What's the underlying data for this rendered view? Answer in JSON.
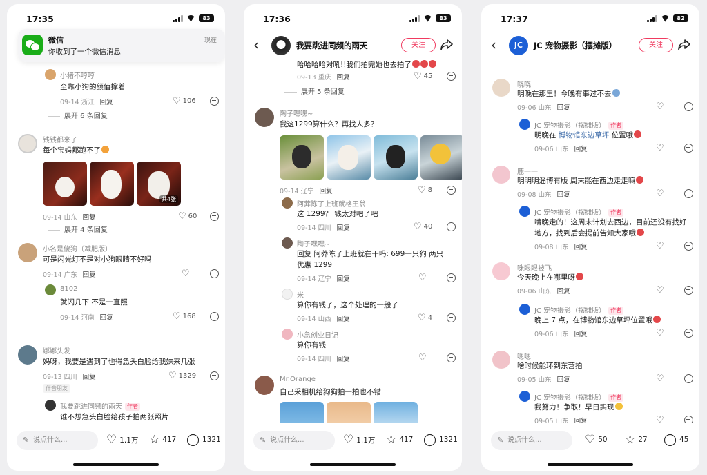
{
  "phones": [
    {
      "time": "17:35",
      "battery": "83",
      "notification": {
        "title": "微信",
        "body": "你收到了一个微信消息",
        "time": "现在"
      },
      "comments": [
        {
          "name": "小猪不哼哼",
          "text": "全靠小狗的颜值撑着",
          "date": "09-14 浙江",
          "reply": "回复",
          "likes": "106"
        },
        {
          "expand": "展开 6 条回复"
        },
        {
          "name": "钱钱都来了",
          "text": "每个宝妈都跑不了",
          "date": "09-14 山东",
          "reply": "回复",
          "likes": "60",
          "image_badge": "共4张"
        },
        {
          "expand": "展开 4 条回复"
        },
        {
          "name": "小名是傻狗（减肥版）",
          "text": "可是闪光灯不是对小狗眼睛不好吗",
          "date": "09-14 广东",
          "reply": "回复",
          "likes": ""
        },
        {
          "name": "8102",
          "text": "就闪几下 不是一直照",
          "date": "09-14 河南",
          "reply": "回复",
          "likes": "168"
        },
        {
          "name": "娜娜头发",
          "text": "妈呀，我要是遇到了也得急头白脸给我妹来几张",
          "date": "09-13 四川",
          "reply": "回复",
          "likes": "1329",
          "badge": "伴音朋友"
        },
        {
          "name": "我要跳进同频的雨天",
          "author_tag": "作者",
          "text": "谁不想急头白脸给孩子拍两张照片"
        }
      ],
      "bottom": {
        "placeholder": "说点什么...",
        "likes": "1.1万",
        "stars": "417",
        "comments": "1321"
      }
    },
    {
      "time": "17:36",
      "battery": "83",
      "title": "我要跳进同频的雨天",
      "follow": "关注",
      "comments": [
        {
          "text": "哈哈哈哈对吼!!我们拍完她也去拍了",
          "date": "09-13 重庆",
          "reply": "回复",
          "likes": "45"
        },
        {
          "expand": "展开 5 条回复"
        },
        {
          "name": "陶子嘿嘿~",
          "text": "我这1299算什么？再找人多？",
          "date": "09-14 辽宁",
          "reply": "回复",
          "likes": "8"
        },
        {
          "name": "阿莽陈了上班就格王翁",
          "text": "这 1299？ 钱太对吧了吧",
          "date": "09-14 四川",
          "reply": "回复",
          "likes": "40"
        },
        {
          "name": "陶子嘿嘿~",
          "text": "回复 阿莽陈了上班就在干吗: 699一只狗 两只",
          "text2": "优惠 1299",
          "date": "09-14 辽宁",
          "reply": "回复",
          "likes": ""
        },
        {
          "name": "米",
          "text": "算你有钱了，这个处理的一般了",
          "date": "09-14 山西",
          "reply": "回复",
          "likes": "4"
        },
        {
          "name": "小急创业日记",
          "text": "算你有钱",
          "date": "09-14 四川",
          "reply": "回复",
          "likes": ""
        },
        {
          "name": "Mr.Orange",
          "text": "自己采相机给狗狗拍一拍也不错"
        }
      ],
      "bottom": {
        "placeholder": "说点什么...",
        "likes": "1.1万",
        "stars": "417",
        "comments": "1321"
      }
    },
    {
      "time": "17:37",
      "battery": "82",
      "title": "JC 宠物摄影（摆摊版）",
      "follow": "关注",
      "comments": [
        {
          "name": "晓晓",
          "text": "明晚在那里！今晚有事过不去",
          "date": "09-06 山东",
          "reply": "回复"
        },
        {
          "name": "JC 宠物摄影（摆摊版）",
          "author_tag": "作者",
          "text_pre": "明晚在 ",
          "text_link": "博物馆东边草坪",
          "text_post": " 位置哦",
          "date": "09-06 山东",
          "reply": "回复"
        },
        {
          "name": "鹿一一",
          "text": "明明明淄博有版 周末能在西边走走嘛",
          "date": "09-08 山东",
          "reply": "回复"
        },
        {
          "name": "JC 宠物摄影（摆摊版）",
          "author_tag": "作者",
          "text": "啃晚走的！这周末计划去西边，目前还没有找好",
          "text2": "地方，找到后会提前告知大家哦",
          "date": "09-08 山东",
          "reply": "回复"
        },
        {
          "name": "咪眼眼被飞",
          "text": "今天晚上在哪里呀",
          "date": "09-06 山东",
          "reply": "回复"
        },
        {
          "name": "JC 宠物摄影（摆摊版）",
          "author_tag": "作者",
          "text": "晚上 7 点，在博物馆东边草坪位置哦",
          "date": "09-06 山东",
          "reply": "回复"
        },
        {
          "name": "嗯嗯",
          "text": "啥时候能环到东营拍",
          "date": "09-05 山东",
          "reply": "回复"
        },
        {
          "name": "JC 宠物摄影（摆摊版）",
          "author_tag": "作者",
          "text": "我努力！争取！早日实现",
          "date": "09-05 山东",
          "reply": "回复"
        }
      ],
      "bottom": {
        "placeholder": "说点什么...",
        "likes": "50",
        "stars": "27",
        "comments": "45"
      }
    }
  ]
}
